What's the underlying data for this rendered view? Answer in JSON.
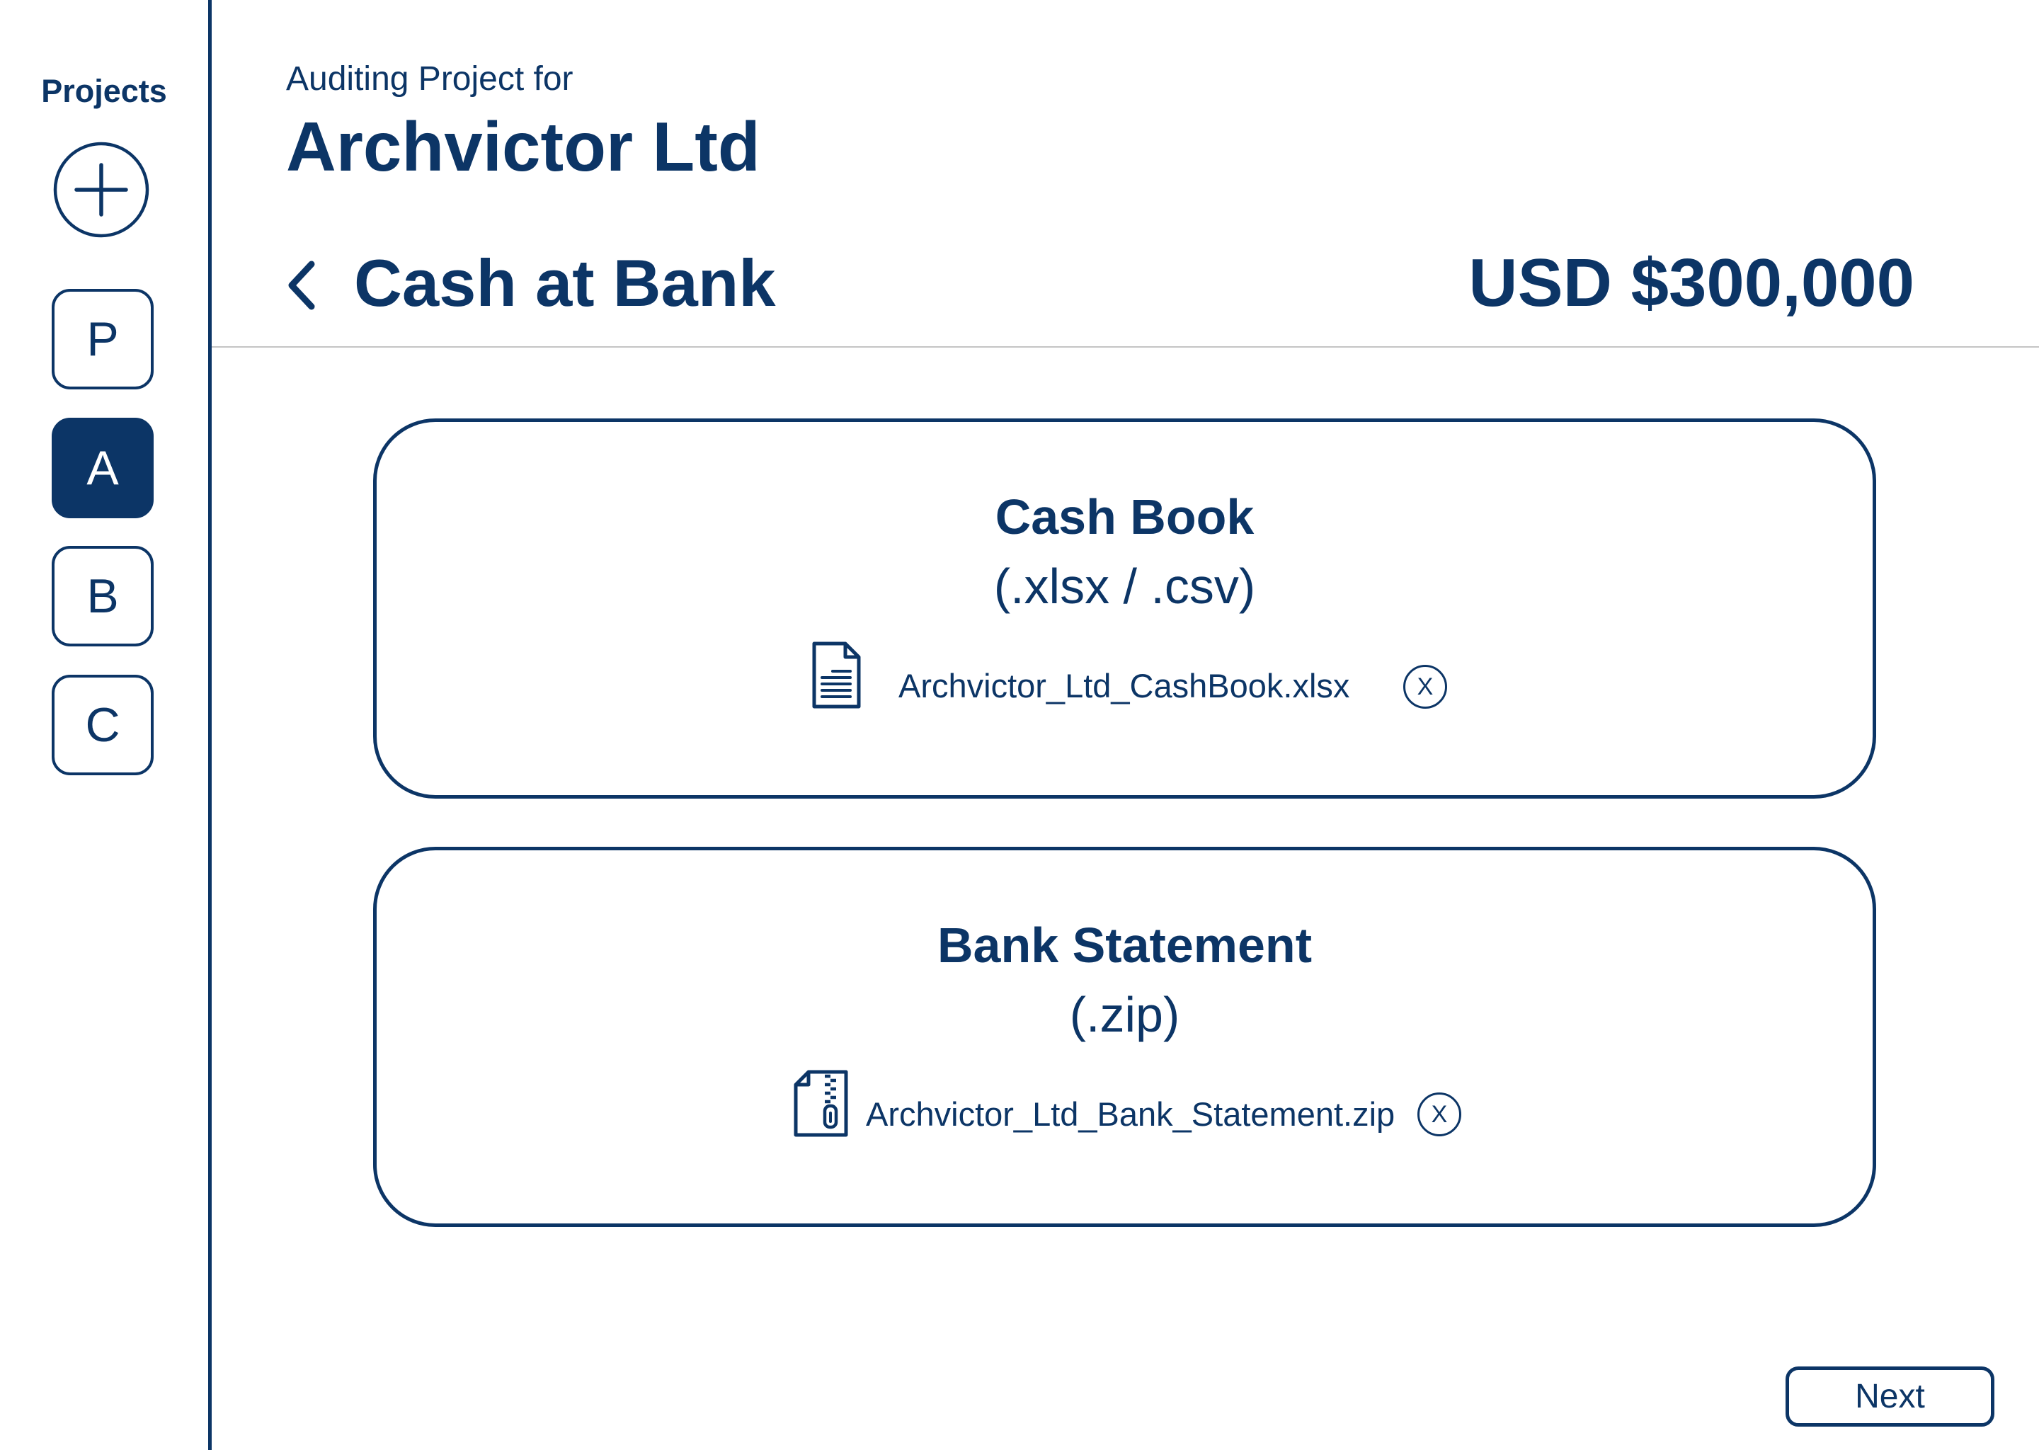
{
  "sidebar": {
    "title": "Projects",
    "add_icon": "plus-circle-icon",
    "projects": [
      {
        "label": "P",
        "active": false
      },
      {
        "label": "A",
        "active": true
      },
      {
        "label": "B",
        "active": false
      },
      {
        "label": "C",
        "active": false
      }
    ]
  },
  "header": {
    "subtitle": "Auditing Project for",
    "company": "Archvictor Ltd",
    "back_icon": "chevron-left-icon",
    "section": "Cash at Bank",
    "amount": "USD $300,000"
  },
  "uploads": [
    {
      "title": "Cash Book",
      "formats": "(.xlsx / .csv)",
      "file_icon": "document-icon",
      "file_name": "Archvictor_Ltd_CashBook.xlsx",
      "remove_label": "X"
    },
    {
      "title": "Bank Statement",
      "formats": "(.zip)",
      "file_icon": "zip-file-icon",
      "file_name": "Archvictor_Ltd_Bank_Statement.zip",
      "remove_label": "X"
    }
  ],
  "footer": {
    "next_label": "Next"
  },
  "colors": {
    "primary": "#0c3566",
    "divider": "#c4c4c4",
    "background": "#ffffff",
    "active_text": "#ffffff"
  }
}
